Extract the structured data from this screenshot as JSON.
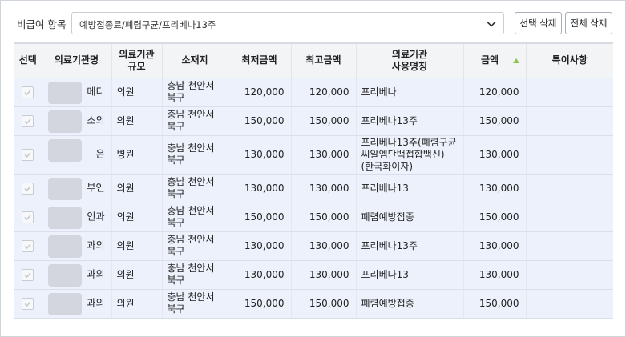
{
  "filter": {
    "label": "비급여 항목",
    "select_value": "예방접종료/폐렴구균/프리베나13주",
    "btn_delete_selected": "선택 삭제",
    "btn_delete_all": "전체 삭제"
  },
  "table": {
    "headers": {
      "select": "선택",
      "name": "의료기관명",
      "scale_1": "의료기관",
      "scale_2": "규모",
      "location": "소재지",
      "min": "최저금액",
      "max": "최고금액",
      "usage_1": "의료기관",
      "usage_2": "사용명칭",
      "amount": "금액",
      "note": "특이사항"
    },
    "rows": [
      {
        "name": "메디",
        "scale": "의원",
        "loc1": "충남 천안서",
        "loc2": "북구",
        "min": "120,000",
        "max": "120,000",
        "usage1": "프리베나",
        "usage2": "",
        "usage3": "",
        "amount": "120,000",
        "note": ""
      },
      {
        "name": "소의",
        "scale": "의원",
        "loc1": "충남 천안서",
        "loc2": "북구",
        "min": "150,000",
        "max": "150,000",
        "usage1": "프리베나13주",
        "usage2": "",
        "usage3": "",
        "amount": "150,000",
        "note": ""
      },
      {
        "name": "은",
        "scale": "병원",
        "loc1": "충남 천안서",
        "loc2": "북구",
        "min": "130,000",
        "max": "130,000",
        "usage1": "프리베나13주(폐렴구균",
        "usage2": "씨알엠단백접합백신)",
        "usage3": "(한국화이자)",
        "amount": "130,000",
        "note": ""
      },
      {
        "name": "부인",
        "scale": "의원",
        "loc1": "충남 천안서",
        "loc2": "북구",
        "min": "130,000",
        "max": "130,000",
        "usage1": "프리베나13",
        "usage2": "",
        "usage3": "",
        "amount": "130,000",
        "note": ""
      },
      {
        "name": "인과",
        "scale": "의원",
        "loc1": "충남 천안서",
        "loc2": "북구",
        "min": "150,000",
        "max": "150,000",
        "usage1": "폐렴예방접종",
        "usage2": "",
        "usage3": "",
        "amount": "150,000",
        "note": ""
      },
      {
        "name": "과의",
        "scale": "의원",
        "loc1": "충남 천안서",
        "loc2": "북구",
        "min": "130,000",
        "max": "130,000",
        "usage1": "프리베나13주",
        "usage2": "",
        "usage3": "",
        "amount": "130,000",
        "note": ""
      },
      {
        "name": "과의",
        "scale": "의원",
        "loc1": "충남 천안서",
        "loc2": "북구",
        "min": "130,000",
        "max": "130,000",
        "usage1": "프리베나13",
        "usage2": "",
        "usage3": "",
        "amount": "130,000",
        "note": ""
      },
      {
        "name": "과의",
        "scale": "의원",
        "loc1": "충남 천안서",
        "loc2": "북구",
        "min": "150,000",
        "max": "150,000",
        "usage1": "폐렴예방접종",
        "usage2": "",
        "usage3": "",
        "amount": "150,000",
        "note": ""
      }
    ]
  },
  "icons": {
    "select_chevron": "chevron-down-icon",
    "sort": "sort-ascending-icon",
    "row_check": "checkmark-icon"
  },
  "colors": {
    "row_bg": "#edf1fc",
    "header_bg": "#f3f4f6",
    "sort_accent": "#8bc34a"
  }
}
